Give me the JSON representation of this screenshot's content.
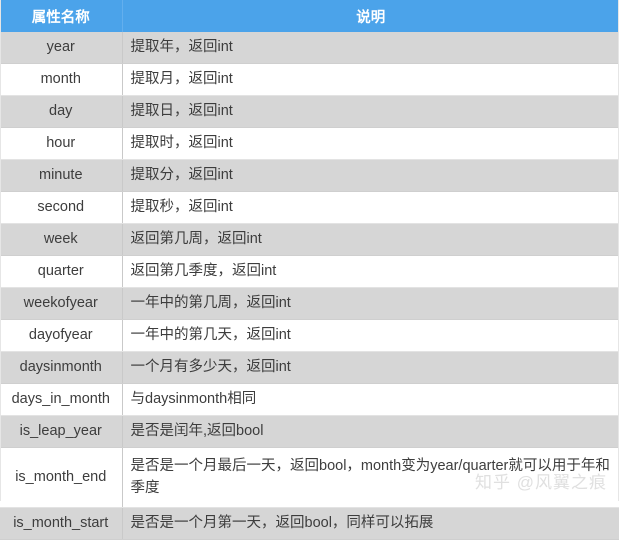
{
  "table": {
    "headers": {
      "name": "属性名称",
      "description": "说明"
    },
    "colors": {
      "header_background": "#4ba3ea",
      "header_text": "#ffffff",
      "row_shaded": "#d6d6d6",
      "row_plain": "#ffffff",
      "body_text": "#3d3d3d",
      "divider": "#c9c9c9"
    },
    "rows": [
      {
        "name": "year",
        "description": "提取年，返回int"
      },
      {
        "name": "month",
        "description": "提取月，返回int"
      },
      {
        "name": "day",
        "description": "提取日，返回int"
      },
      {
        "name": "hour",
        "description": "提取时，返回int"
      },
      {
        "name": "minute",
        "description": "提取分，返回int"
      },
      {
        "name": "second",
        "description": "提取秒，返回int"
      },
      {
        "name": "week",
        "description": "返回第几周，返回int"
      },
      {
        "name": "quarter",
        "description": "返回第几季度，返回int"
      },
      {
        "name": "weekofyear",
        "description": "一年中的第几周，返回int"
      },
      {
        "name": "dayofyear",
        "description": "一年中的第几天，返回int"
      },
      {
        "name": "daysinmonth",
        "description": "一个月有多少天，返回int"
      },
      {
        "name": "days_in_month",
        "description": "与daysinmonth相同"
      },
      {
        "name": "is_leap_year",
        "description": "是否是闰年,返回bool"
      },
      {
        "name": "is_month_end",
        "description": "是否是一个月最后一天，返回bool，month变为year/quarter就可以用于年和季度"
      },
      {
        "name": "is_month_start",
        "description": "是否是一个月第一天，返回bool，同样可以拓展"
      }
    ]
  },
  "watermark": {
    "text": "知乎 @风翼之痕"
  }
}
